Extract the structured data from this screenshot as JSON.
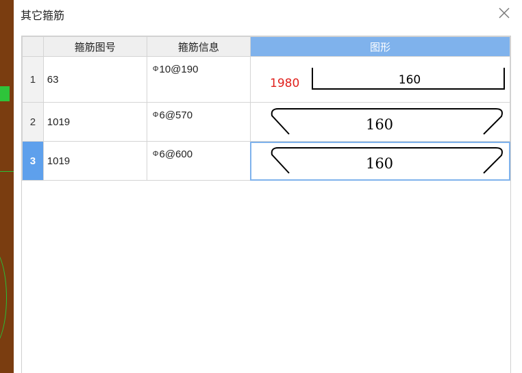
{
  "dialog": {
    "title": "其它箍筋"
  },
  "table": {
    "columns": {
      "index": "",
      "code": "箍筋图号",
      "info": "箍筋信息",
      "shape": "图形"
    },
    "rows": [
      {
        "index": "1",
        "code": "63",
        "steel_symbol": "Φ",
        "info": "10@190",
        "shape": {
          "left_label": "1980",
          "center_label": "160",
          "type": "straight-with-hooks"
        },
        "selected": false
      },
      {
        "index": "2",
        "code": "1019",
        "steel_symbol": "Φ",
        "info": "6@570",
        "shape": {
          "center_label": "160",
          "type": "bent-hooks"
        },
        "selected": false
      },
      {
        "index": "3",
        "code": "1019",
        "steel_symbol": "Φ",
        "info": "6@600",
        "shape": {
          "center_label": "160",
          "type": "bent-hooks"
        },
        "selected": true
      }
    ]
  },
  "colors": {
    "header_highlight": "#7fb2ec",
    "selected_index": "#5ea0ec",
    "dimension_red": "#e0201c",
    "background_app": "#7a3d10"
  }
}
